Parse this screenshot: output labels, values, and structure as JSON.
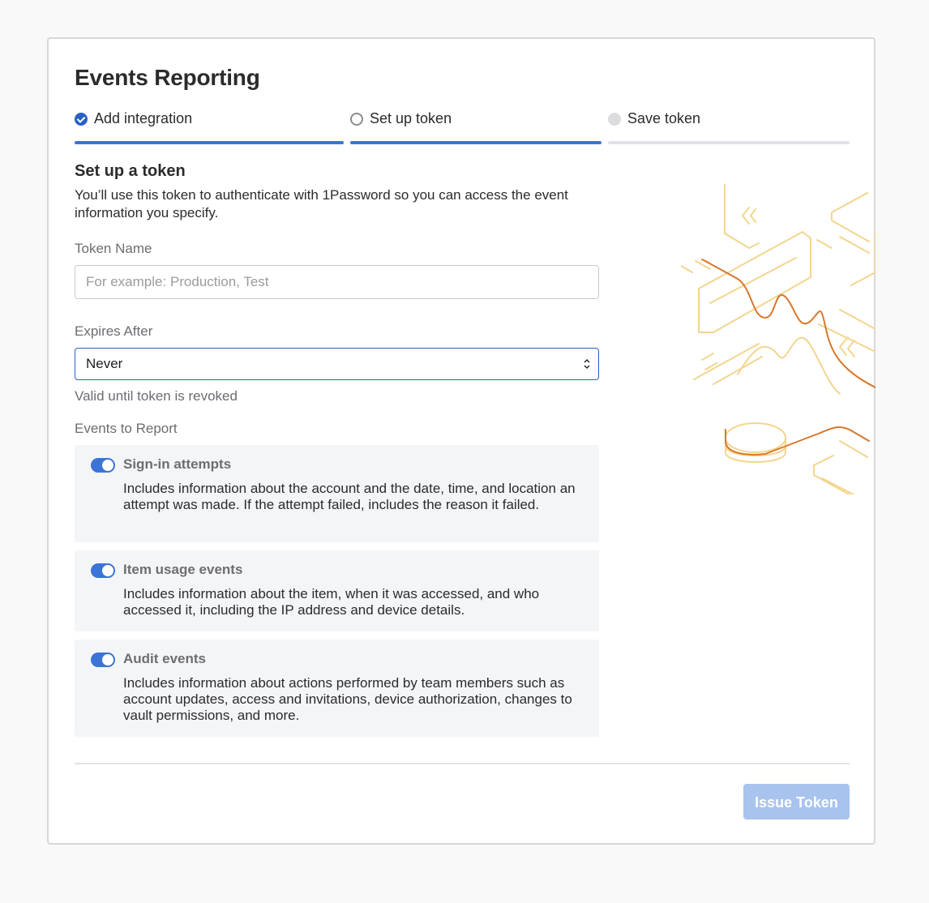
{
  "page": {
    "title": "Events Reporting"
  },
  "steps": [
    {
      "label": "Add integration",
      "state": "done"
    },
    {
      "label": "Set up token",
      "state": "current"
    },
    {
      "label": "Save token",
      "state": "upcoming"
    }
  ],
  "section": {
    "title": "Set up a token",
    "description": "You’ll use this token to authenticate with 1Password so you can access the event information you specify."
  },
  "token_name": {
    "label": "Token Name",
    "value": "",
    "placeholder": "For example: Production, Test"
  },
  "expires_after": {
    "label": "Expires After",
    "selected": "Never",
    "help": "Valid until token is revoked"
  },
  "events": {
    "label": "Events to Report",
    "items": [
      {
        "title": "Sign-in attempts",
        "enabled": true,
        "description": "Includes information about the account and the date, time, and location an attempt was made. If the attempt failed, includes the reason it failed."
      },
      {
        "title": "Item usage events",
        "enabled": true,
        "description": "Includes information about the item, when it was accessed, and who accessed it, including the IP address and device details."
      },
      {
        "title": "Audit events",
        "enabled": true,
        "description": "Includes information about actions performed by team members such as account updates, access and invitations, device authorization, changes to vault permissions, and more."
      }
    ]
  },
  "footer": {
    "issue_label": "Issue Token"
  },
  "colors": {
    "accent": "#3b74d6",
    "button_disabled": "#a9c3ef",
    "illustration_light": "#f3d58e",
    "illustration_dark": "#d9772b"
  },
  "icons": {
    "step_done": "check-circle-icon",
    "step_current": "empty-circle-icon",
    "step_upcoming": "filled-grey-circle-icon",
    "select_chevron": "up-down-chevron-icon"
  }
}
